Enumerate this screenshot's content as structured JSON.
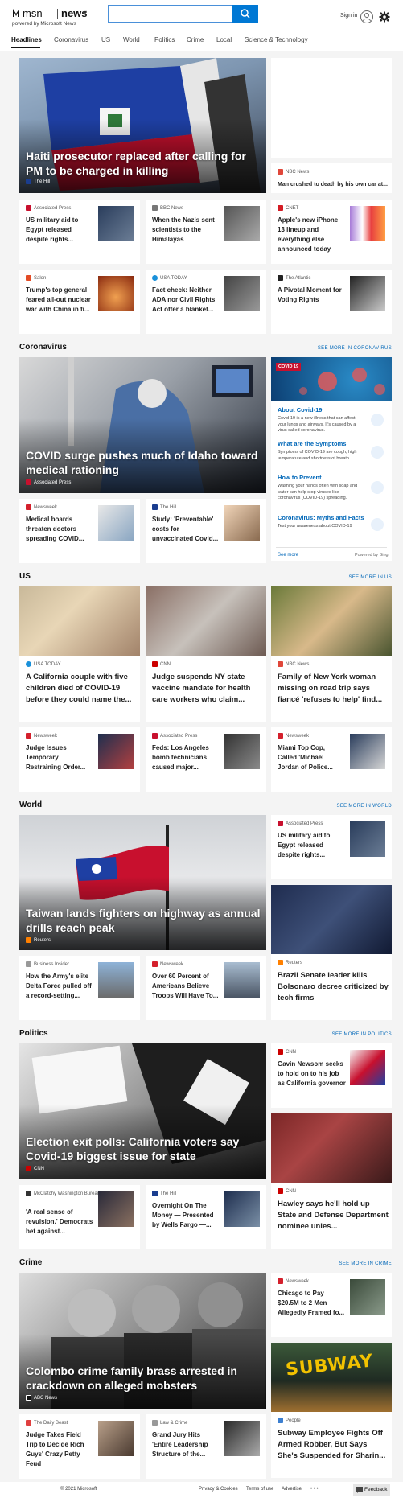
{
  "header": {
    "logo_text": "msn",
    "logo_news": "news",
    "powered_by": "powered by Microsoft News",
    "search_placeholder": "",
    "sign_in": "Sign in"
  },
  "nav": {
    "items": [
      "Headlines",
      "Coronavirus",
      "US",
      "World",
      "Politics",
      "Crime",
      "Local",
      "Science & Technology"
    ]
  },
  "top": {
    "hero_title": "Haiti prosecutor replaced after calling for PM to be charged in killing",
    "hero_source": "The Hill",
    "side_source": "NBC News",
    "side_title": "Man crushed to death by his own car at...",
    "row1": [
      {
        "source": "Associated Press",
        "title": "US military aid to Egypt released despite rights..."
      },
      {
        "source": "BBC News",
        "title": "When the Nazis sent scientists to the Himalayas"
      },
      {
        "source": "CNET",
        "title": "Apple's new iPhone 13 lineup and everything else announced today"
      }
    ],
    "row2": [
      {
        "source": "Salon",
        "title": "Trump's top general feared all-out nuclear war with China in fi..."
      },
      {
        "source": "USA TODAY",
        "title": "Fact check: Neither ADA nor Civil Rights Act offer a blanket..."
      },
      {
        "source": "The Atlantic",
        "title": "A Pivotal Moment for Voting Rights"
      }
    ]
  },
  "coronavirus": {
    "title": "Coronavirus",
    "see_more": "SEE MORE IN CORONAVIRUS",
    "hero_title": "COVID surge pushes much of Idaho toward medical rationing",
    "hero_source": "Associated Press",
    "cards": [
      {
        "source": "Newsweek",
        "title": "Medical boards threaten doctors spreading COVID..."
      },
      {
        "source": "The Hill",
        "title": "Study: 'Preventable' costs for unvaccinated Covid..."
      }
    ],
    "panel": {
      "badge": "COVID 19",
      "items": [
        {
          "title": "About Covid-19",
          "text": "Covid-19 is a new illness that can affect your lungs and airways. It's caused by a virus called coronavirus."
        },
        {
          "title": "What are the Symptoms",
          "text": "Symptoms of COVID-19 are cough, high temperature and shortness of breath."
        },
        {
          "title": "How to Prevent",
          "text": "Washing your hands often with soap and water can help stop viruses like coronavirus (COVID-19) spreading."
        },
        {
          "title": "Coronavirus: Myths and Facts",
          "text": "Test your awareness about COVID-19"
        }
      ],
      "see_more": "See more",
      "powered": "Powered by Bing"
    }
  },
  "us": {
    "title": "US",
    "see_more": "SEE MORE IN US",
    "big": [
      {
        "source": "USA TODAY",
        "title": "A California couple with five children died of COVID-19 before they could name the..."
      },
      {
        "source": "CNN",
        "title": "Judge suspends NY state vaccine mandate for health care workers who claim..."
      },
      {
        "source": "NBC News",
        "title": "Family of New York woman missing on road trip says fiancé 'refuses to help' find..."
      }
    ],
    "small": [
      {
        "source": "Newsweek",
        "title": "Judge Issues Temporary Restraining Order..."
      },
      {
        "source": "Associated Press",
        "title": "Feds: Los Angeles bomb technicians caused major..."
      },
      {
        "source": "Newsweek",
        "title": "Miami Top Cop, Called 'Michael Jordan of Police..."
      }
    ]
  },
  "world": {
    "title": "World",
    "see_more": "SEE MORE IN WORLD",
    "hero_title": "Taiwan lands fighters on highway as annual drills reach peak",
    "hero_source": "Reuters",
    "side_small": {
      "source": "Associated Press",
      "title": "US military aid to Egypt released despite rights..."
    },
    "side_big": {
      "source": "Reuters",
      "title": "Brazil Senate leader kills Bolsonaro decree criticized by tech firms"
    },
    "cards": [
      {
        "source": "Business Insider",
        "title": "How the Army's elite Delta Force pulled off a record-setting..."
      },
      {
        "source": "Newsweek",
        "title": "Over 60 Percent of Americans Believe Troops Will Have To..."
      }
    ]
  },
  "politics": {
    "title": "Politics",
    "see_more": "SEE MORE IN POLITICS",
    "hero_title": "Election exit polls: California voters say Covid-19 biggest issue for state",
    "hero_source": "CNN",
    "side_small": {
      "source": "CNN",
      "title": "Gavin Newsom seeks to hold on to his job as California governor"
    },
    "side_big": {
      "source": "CNN",
      "title": "Hawley says he'll hold up State and Defense Department nominee unles..."
    },
    "cards": [
      {
        "source": "McClatchy Washington Bureau",
        "title": "'A real sense of revulsion.' Democrats bet against..."
      },
      {
        "source": "The Hill",
        "title": "Overnight On The Money — Presented by Wells Fargo —..."
      }
    ]
  },
  "crime": {
    "title": "Crime",
    "see_more": "SEE MORE IN CRIME",
    "hero_title": "Colombo crime family brass arrested in crackdown on alleged mobsters",
    "hero_source": "ABC News",
    "side_small": {
      "source": "Newsweek",
      "title": "Chicago to Pay $20.5M to 2 Men Allegedly Framed fo..."
    },
    "side_big": {
      "source": "People",
      "title": "Subway Employee Fights Off Armed Robber, But Says She's Suspended for Sharin..."
    },
    "cards": [
      {
        "source": "The Daily Beast",
        "title": "Judge Takes Field Trip to Decide Rich Guys' Crazy Petty Feud"
      },
      {
        "source": "Law & Crime",
        "title": "Grand Jury Hits 'Entire Leadership Structure of the..."
      }
    ]
  },
  "footer": {
    "copyright": "© 2021 Microsoft",
    "privacy": "Privacy & Cookies",
    "terms": "Terms of use",
    "advertise": "Advertise",
    "more": "• • •",
    "feedback": "Feedback"
  }
}
